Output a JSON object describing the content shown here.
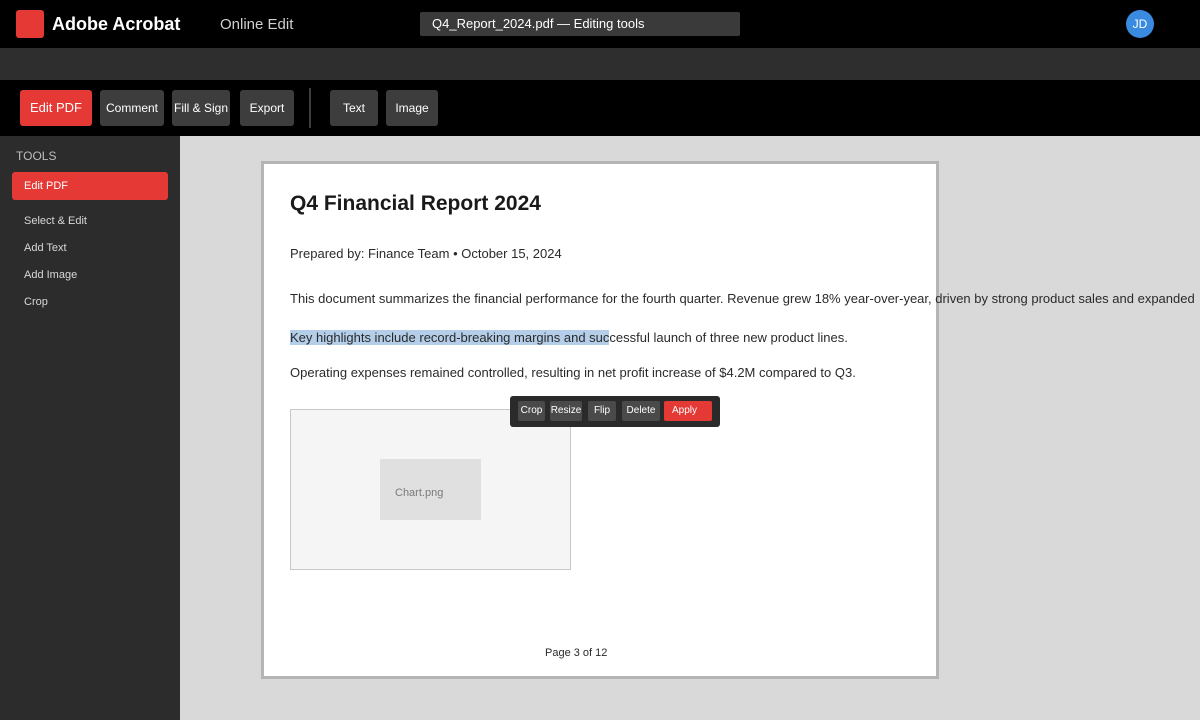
{
  "header": {
    "app_title": "Adobe Acrobat",
    "mode": "Online Edit",
    "document_title": "Q4_Report_2024.pdf — Editing tools",
    "avatar_initials": "JD"
  },
  "toolbar": {
    "edit_pdf": "Edit PDF",
    "comment": "Comment",
    "fill_sign": "Fill & Sign",
    "export": "Export",
    "text": "Text",
    "image": "Image"
  },
  "sidebar": {
    "heading": "TOOLS",
    "active": "Edit PDF",
    "items": [
      {
        "label": "Select & Edit"
      },
      {
        "label": "Add Text"
      },
      {
        "label": "Add Image"
      },
      {
        "label": "Crop"
      }
    ]
  },
  "document": {
    "heading": "Q4 Financial Report 2024",
    "subtitle": "Prepared by: Finance Team • October 15, 2024",
    "paragraph1": "This document summarizes the financial performance for the fourth quarter. Revenue grew 18% year-over-year, driven by strong product sales and expanded",
    "paragraph2_selected": "Key highlights include record-breaking margins and suc",
    "paragraph2_rest": "cessful launch of three new product lines.",
    "paragraph3": "Operating expenses remained controlled, resulting in net profit increase of $4.2M compared to Q3.",
    "image_label": "Chart.png",
    "page_indicator": "Page 3 of 12"
  },
  "image_toolbar": {
    "crop": "Crop",
    "resize": "Resize",
    "flip": "Flip",
    "delete": "Delete",
    "apply": "Apply"
  },
  "colors": {
    "accent": "#e53935",
    "topbar": "#000000",
    "sidebar": "#2c2c2c",
    "selection": "#b4cde8",
    "avatar": "#3a8be0"
  }
}
